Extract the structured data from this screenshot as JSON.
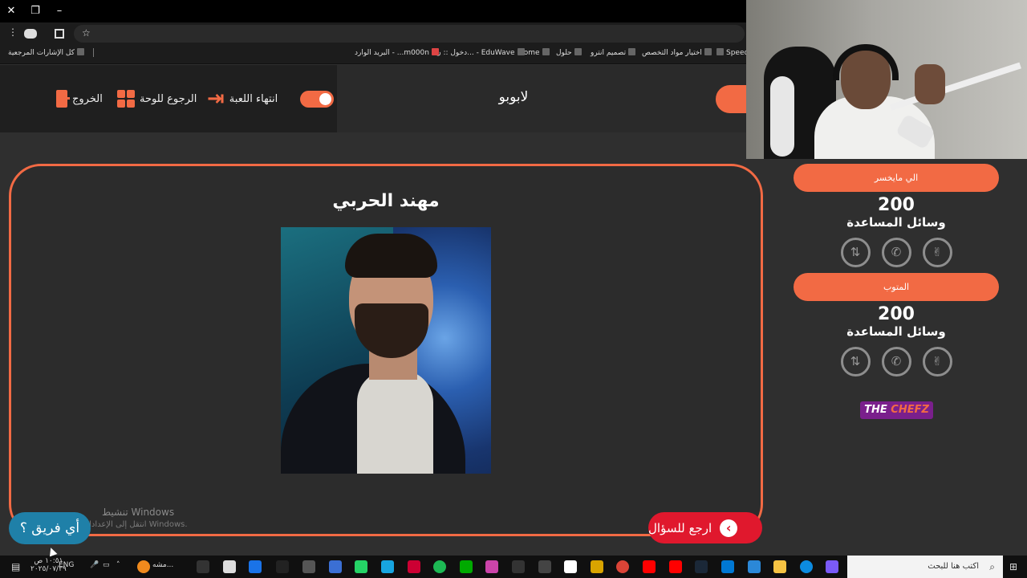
{
  "browser": {
    "close": "✕",
    "restore": "❐",
    "minimize": "–",
    "menu": "⋮",
    "star": "☆"
  },
  "bookmarks": [
    {
      "label": "Speedtest"
    },
    {
      "label": "اختيار مواد التخصص"
    },
    {
      "label": "تصميم انترو"
    },
    {
      "label": "حلول"
    },
    {
      "label": "Home"
    },
    {
      "label": "دخول :: ن... - EduWave"
    },
    {
      "label": "البريد الوارد - ...m000n"
    },
    {
      "label": "كل الإشارات المرجعية"
    }
  ],
  "header": {
    "exit_label": "الخروج",
    "board_label": "الرجوع للوحة",
    "end_game_label": "انتهاء اللعبة",
    "game_title": "لابوبو"
  },
  "main": {
    "person_name": "مهند الحربي",
    "back_button": "ارجع للسؤال",
    "team_button": "أي فريق ؟",
    "watermark_title": "تنشيط Windows",
    "watermark_sub": "انتقل إلى الإعدادات لتنشيط Windows."
  },
  "teams": [
    {
      "name": "الي مايخسر",
      "score": "200",
      "aids_label": "وسائل المساعدة"
    },
    {
      "name": "المتوب",
      "score": "200",
      "aids_label": "وسائل المساعدة"
    }
  ],
  "aids_icons": [
    "peace-icon",
    "phone-icon",
    "call-switch-icon"
  ],
  "sponsor": {
    "part1": "THE",
    "part2": "CHEFZ"
  },
  "taskbar": {
    "search_placeholder": "اكتب هنا للبحث",
    "lang": "ENG",
    "time": "١٠:٥١ ص",
    "date": "٢٠٢٥/٠٧/٢٩",
    "app_label": "مشه..."
  },
  "colors": {
    "accent": "#f26a44",
    "back_button": "#e0182d",
    "team_button": "#1f80a8",
    "background": "#2f2f2f"
  }
}
